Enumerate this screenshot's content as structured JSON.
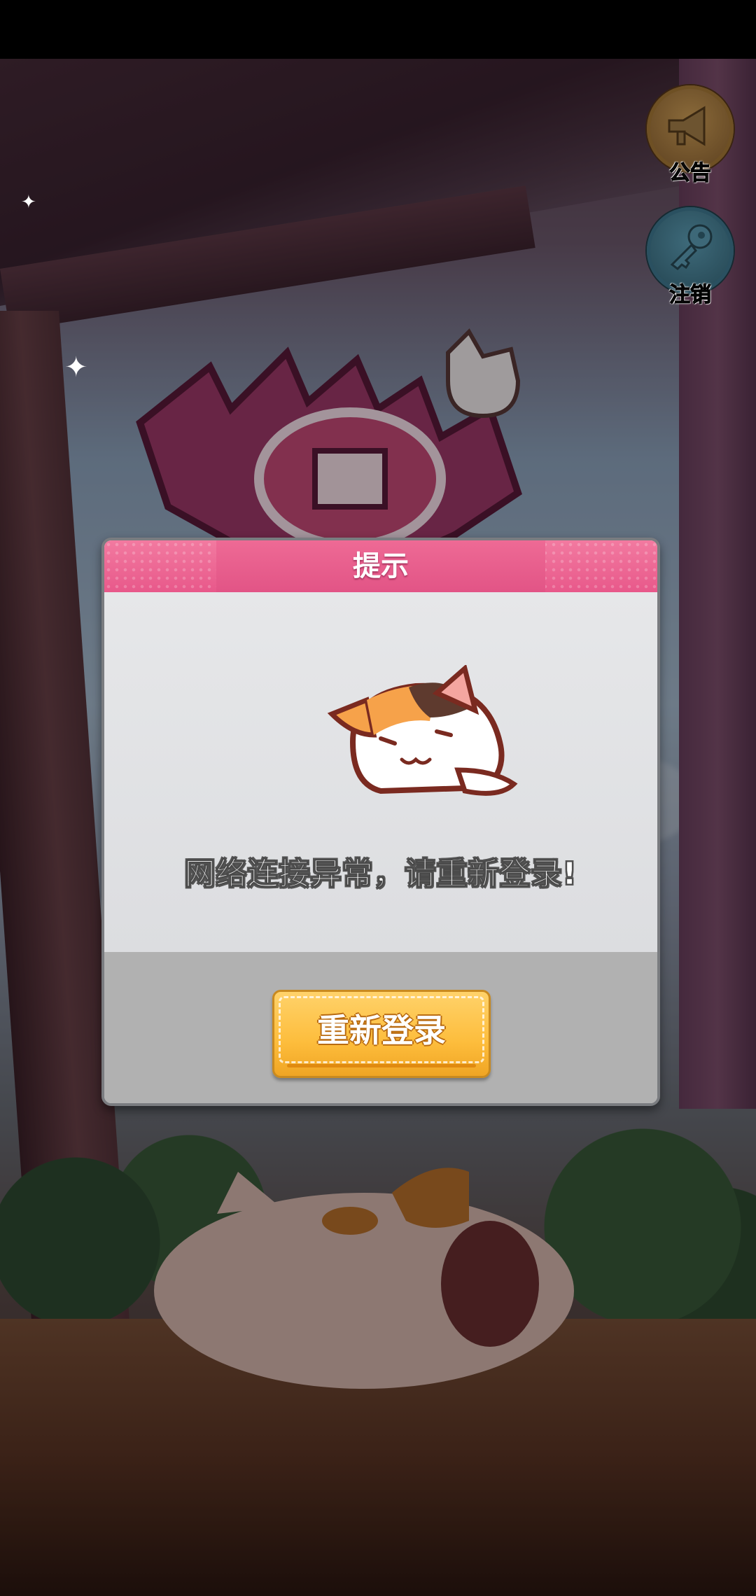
{
  "side_buttons": {
    "announce_label": "公告",
    "logout_label": "注销"
  },
  "dialog": {
    "title": "提示",
    "message": "网络连接异常，请重新登录!",
    "relogin_label": "重新登录"
  },
  "colors": {
    "header_pink": "#e8588a",
    "button_yellow": "#fdbd3c",
    "dialog_body": "#dcdde0",
    "dialog_footer": "#b1b1b1"
  },
  "icons": {
    "announce": "megaphone-icon",
    "logout": "key-icon",
    "dialog_art": "sleeping-cat-icon"
  }
}
